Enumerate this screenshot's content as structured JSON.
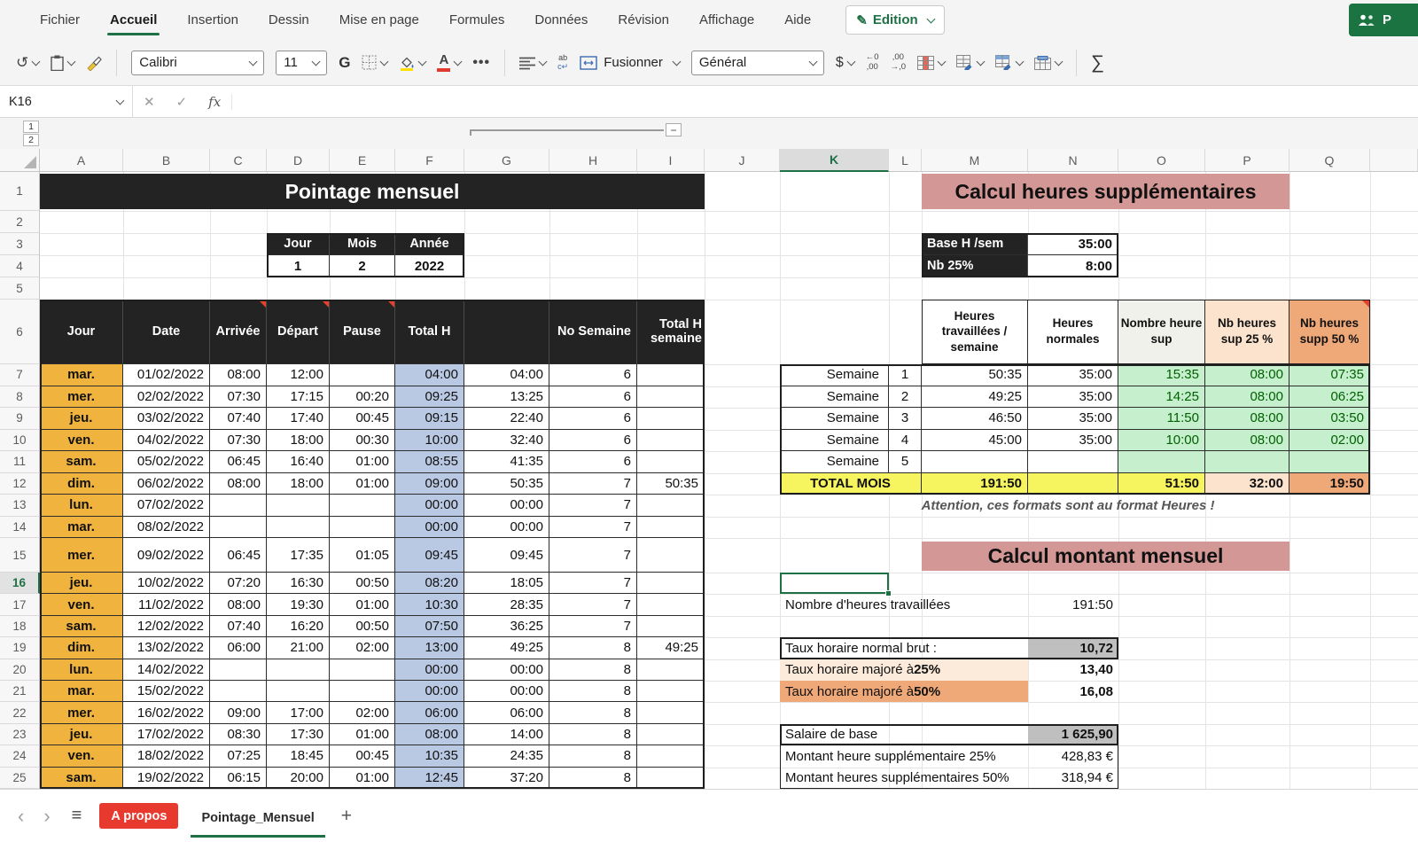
{
  "chrome": {
    "menu": {
      "items": [
        "Fichier",
        "Accueil",
        "Insertion",
        "Dessin",
        "Mise en page",
        "Formules",
        "Données",
        "Révision",
        "Affichage",
        "Aide"
      ],
      "active": "Accueil",
      "edition_label": "Edition",
      "share_label": "P"
    },
    "toolbar": {
      "font_name": "Calibri",
      "font_size": "11",
      "bold_label": "G",
      "merge_label": "Fusionner",
      "number_format": "Général",
      "currency_label": "$",
      "more_label": "•••",
      "sum_label": "∑",
      "undo_label": "↺",
      "increase_decimal": [
        "←0",
        ",00"
      ],
      "decrease_decimal": [
        ",00",
        "→,0"
      ],
      "wrap_lines": [
        "ab",
        "c↵"
      ]
    },
    "formula_bar": {
      "name_box": "K16",
      "cancel_label": "✕",
      "enter_label": "✓",
      "fx_label": "fx",
      "formula_value": ""
    },
    "outline": {
      "levels": [
        "1",
        "2"
      ],
      "collapse_label": "−"
    },
    "sheet_tabs": {
      "prev_label": "‹",
      "next_label": "›",
      "menu_label": "≡",
      "tabs": [
        {
          "label": "A propos",
          "style": "red"
        },
        {
          "label": "Pointage_Mensuel",
          "style": "active"
        }
      ],
      "add_label": "+"
    }
  },
  "grid": {
    "columns": [
      "A",
      "B",
      "C",
      "D",
      "E",
      "F",
      "G",
      "H",
      "I",
      "J",
      "K",
      "L",
      "M",
      "N",
      "O",
      "P",
      "Q"
    ],
    "selected_column": "K",
    "selected_row": 16,
    "row_count": 25
  },
  "palette": {
    "accent_green": "#1e7145",
    "dark_cell": "#232323",
    "day_orange": "#f0b43e",
    "totalh_blue": "#b9c9e3",
    "banner_pink": "#d39795",
    "green_bg": "#c6efce",
    "green_text": "#006100",
    "total_yellow": "#f7f55f",
    "peach": "#fbe3cd",
    "orange": "#efa878",
    "peach_light": "#fcebdb",
    "gray_fill": "#bfbfbf",
    "tab_red": "#e8392e",
    "comment_red": "#e8402f"
  },
  "left": {
    "title": "Pointage mensuel",
    "date_selector": {
      "headers": [
        "Jour",
        "Mois",
        "Année"
      ],
      "values": [
        "1",
        "2",
        "2022"
      ]
    },
    "table": {
      "headers": [
        "Jour",
        "Date",
        "Arrivée",
        "Départ",
        "Pause",
        "Total H",
        "",
        "No Semaine",
        "Total H semaine"
      ],
      "comment_cols": [
        2,
        3,
        4
      ],
      "rows": [
        [
          "mar.",
          "01/02/2022",
          "08:00",
          "12:00",
          "",
          "04:00",
          "04:00",
          "6",
          ""
        ],
        [
          "mer.",
          "02/02/2022",
          "07:30",
          "17:15",
          "00:20",
          "09:25",
          "13:25",
          "6",
          ""
        ],
        [
          "jeu.",
          "03/02/2022",
          "07:40",
          "17:40",
          "00:45",
          "09:15",
          "22:40",
          "6",
          ""
        ],
        [
          "ven.",
          "04/02/2022",
          "07:30",
          "18:00",
          "00:30",
          "10:00",
          "32:40",
          "6",
          ""
        ],
        [
          "sam.",
          "05/02/2022",
          "06:45",
          "16:40",
          "01:00",
          "08:55",
          "41:35",
          "6",
          ""
        ],
        [
          "dim.",
          "06/02/2022",
          "08:00",
          "18:00",
          "01:00",
          "09:00",
          "50:35",
          "7",
          "50:35"
        ],
        [
          "lun.",
          "07/02/2022",
          "",
          "",
          "",
          "00:00",
          "00:00",
          "7",
          ""
        ],
        [
          "mar.",
          "08/02/2022",
          "",
          "",
          "",
          "00:00",
          "00:00",
          "7",
          ""
        ],
        [
          "mer.",
          "09/02/2022",
          "06:45",
          "17:35",
          "01:05",
          "09:45",
          "09:45",
          "7",
          ""
        ],
        [
          "jeu.",
          "10/02/2022",
          "07:20",
          "16:30",
          "00:50",
          "08:20",
          "18:05",
          "7",
          ""
        ],
        [
          "ven.",
          "11/02/2022",
          "08:00",
          "19:30",
          "01:00",
          "10:30",
          "28:35",
          "7",
          ""
        ],
        [
          "sam.",
          "12/02/2022",
          "07:40",
          "16:20",
          "00:50",
          "07:50",
          "36:25",
          "7",
          ""
        ],
        [
          "dim.",
          "13/02/2022",
          "06:00",
          "21:00",
          "02:00",
          "13:00",
          "49:25",
          "8",
          "49:25"
        ],
        [
          "lun.",
          "14/02/2022",
          "",
          "",
          "",
          "00:00",
          "00:00",
          "8",
          ""
        ],
        [
          "mar.",
          "15/02/2022",
          "",
          "",
          "",
          "00:00",
          "00:00",
          "8",
          ""
        ],
        [
          "mer.",
          "16/02/2022",
          "09:00",
          "17:00",
          "02:00",
          "06:00",
          "06:00",
          "8",
          ""
        ],
        [
          "jeu.",
          "17/02/2022",
          "08:30",
          "17:30",
          "01:00",
          "08:00",
          "14:00",
          "8",
          ""
        ],
        [
          "ven.",
          "18/02/2022",
          "07:25",
          "18:45",
          "00:45",
          "10:35",
          "24:35",
          "8",
          ""
        ],
        [
          "sam.",
          "19/02/2022",
          "06:15",
          "20:00",
          "01:00",
          "12:45",
          "37:20",
          "8",
          ""
        ]
      ]
    }
  },
  "right": {
    "overtime": {
      "title": "Calcul heures supplémentaires",
      "params": [
        {
          "label": "Base H /sem",
          "value": "35:00"
        },
        {
          "label": "Nb 25%",
          "value": "8:00"
        }
      ],
      "headers": [
        "Heures travaillées / semaine",
        "Heures normales",
        "Nombre heure sup",
        "Nb heures sup 25 %",
        "Nb heures supp 50 %"
      ],
      "weeks": [
        {
          "label": "Semaine",
          "num": "1",
          "worked": "50:35",
          "normal": "35:00",
          "sup": "15:35",
          "sup25": "08:00",
          "sup50": "07:35"
        },
        {
          "label": "Semaine",
          "num": "2",
          "worked": "49:25",
          "normal": "35:00",
          "sup": "14:25",
          "sup25": "08:00",
          "sup50": "06:25"
        },
        {
          "label": "Semaine",
          "num": "3",
          "worked": "46:50",
          "normal": "35:00",
          "sup": "11:50",
          "sup25": "08:00",
          "sup50": "03:50"
        },
        {
          "label": "Semaine",
          "num": "4",
          "worked": "45:00",
          "normal": "35:00",
          "sup": "10:00",
          "sup25": "08:00",
          "sup50": "02:00"
        },
        {
          "label": "Semaine",
          "num": "5",
          "worked": "",
          "normal": "",
          "sup": "",
          "sup25": "",
          "sup50": ""
        }
      ],
      "total": {
        "label": "TOTAL MOIS",
        "worked": "191:50",
        "normal": "",
        "sup": "51:50",
        "sup25": "32:00",
        "sup50": "19:50"
      },
      "note": "Attention, ces formats sont au format Heures !"
    },
    "monthly": {
      "title": "Calcul montant mensuel",
      "hours_label": "Nombre d'heures travaillées",
      "hours_value": "191:50",
      "rates": [
        {
          "label": "Taux horaire normal brut :",
          "pct": "",
          "value": "10,72",
          "style": "normal"
        },
        {
          "label": "Taux horaire majoré à ",
          "pct": "25%",
          "value": "13,40",
          "style": "p25"
        },
        {
          "label": "Taux horaire majoré à ",
          "pct": "50%",
          "value": "16,08",
          "style": "p50"
        }
      ],
      "amounts": [
        {
          "label": "Salaire de base",
          "value": "1 625,90",
          "style": "gray"
        },
        {
          "label": "Montant heure supplémentaire 25%",
          "value": "428,83 €",
          "style": "plain"
        },
        {
          "label": "Montant heures supplémentaires 50%",
          "value": "318,94 €",
          "style": "plain"
        }
      ]
    }
  }
}
